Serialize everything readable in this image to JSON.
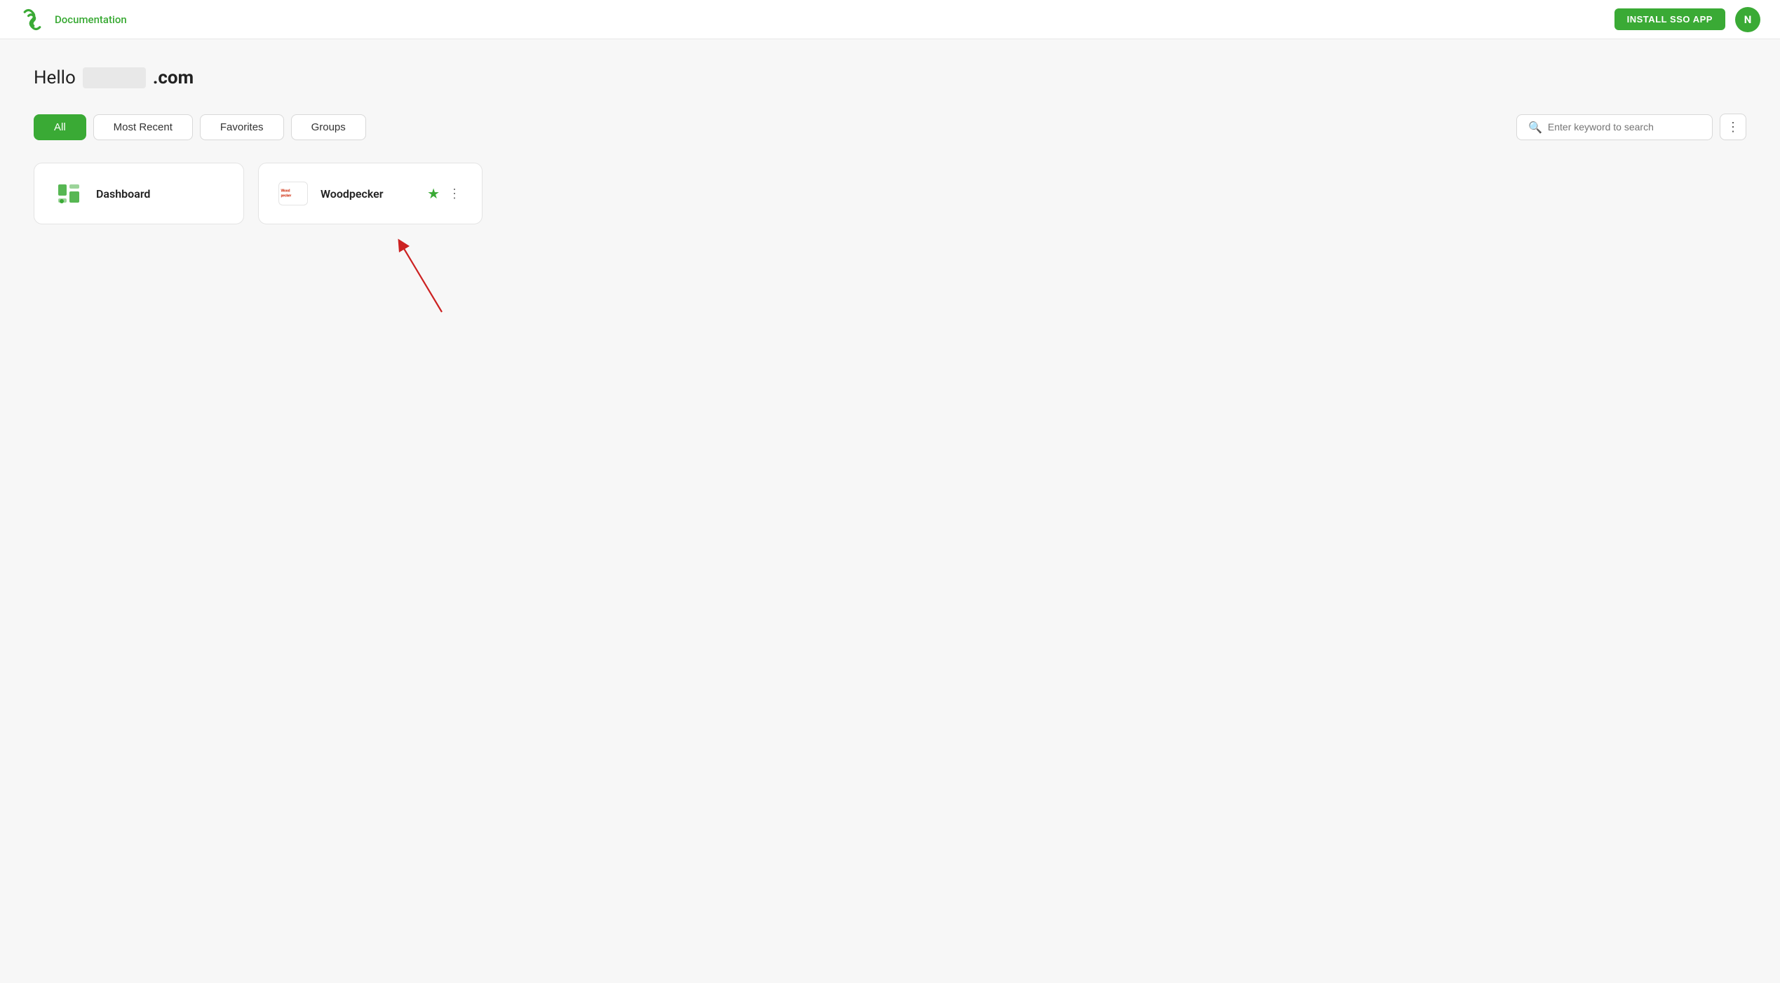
{
  "header": {
    "logo_alt": "Logo",
    "doc_link": "Documentation",
    "install_btn": "INSTALL SSO APP",
    "avatar_initials": "N"
  },
  "greeting": {
    "hello": "Hello",
    "name_placeholder": "",
    "domain": ".com"
  },
  "filter_tabs": [
    {
      "id": "all",
      "label": "All",
      "active": true
    },
    {
      "id": "most-recent",
      "label": "Most Recent",
      "active": false
    },
    {
      "id": "favorites",
      "label": "Favorites",
      "active": false
    },
    {
      "id": "groups",
      "label": "Groups",
      "active": false
    }
  ],
  "search": {
    "placeholder": "Enter keyword to search"
  },
  "cards": [
    {
      "id": "dashboard",
      "title": "Dashboard",
      "icon_type": "dashboard",
      "has_star": false,
      "has_menu": false
    },
    {
      "id": "woodpecker",
      "title": "Woodpecker",
      "icon_type": "woodpecker",
      "has_star": true,
      "has_menu": true
    }
  ]
}
